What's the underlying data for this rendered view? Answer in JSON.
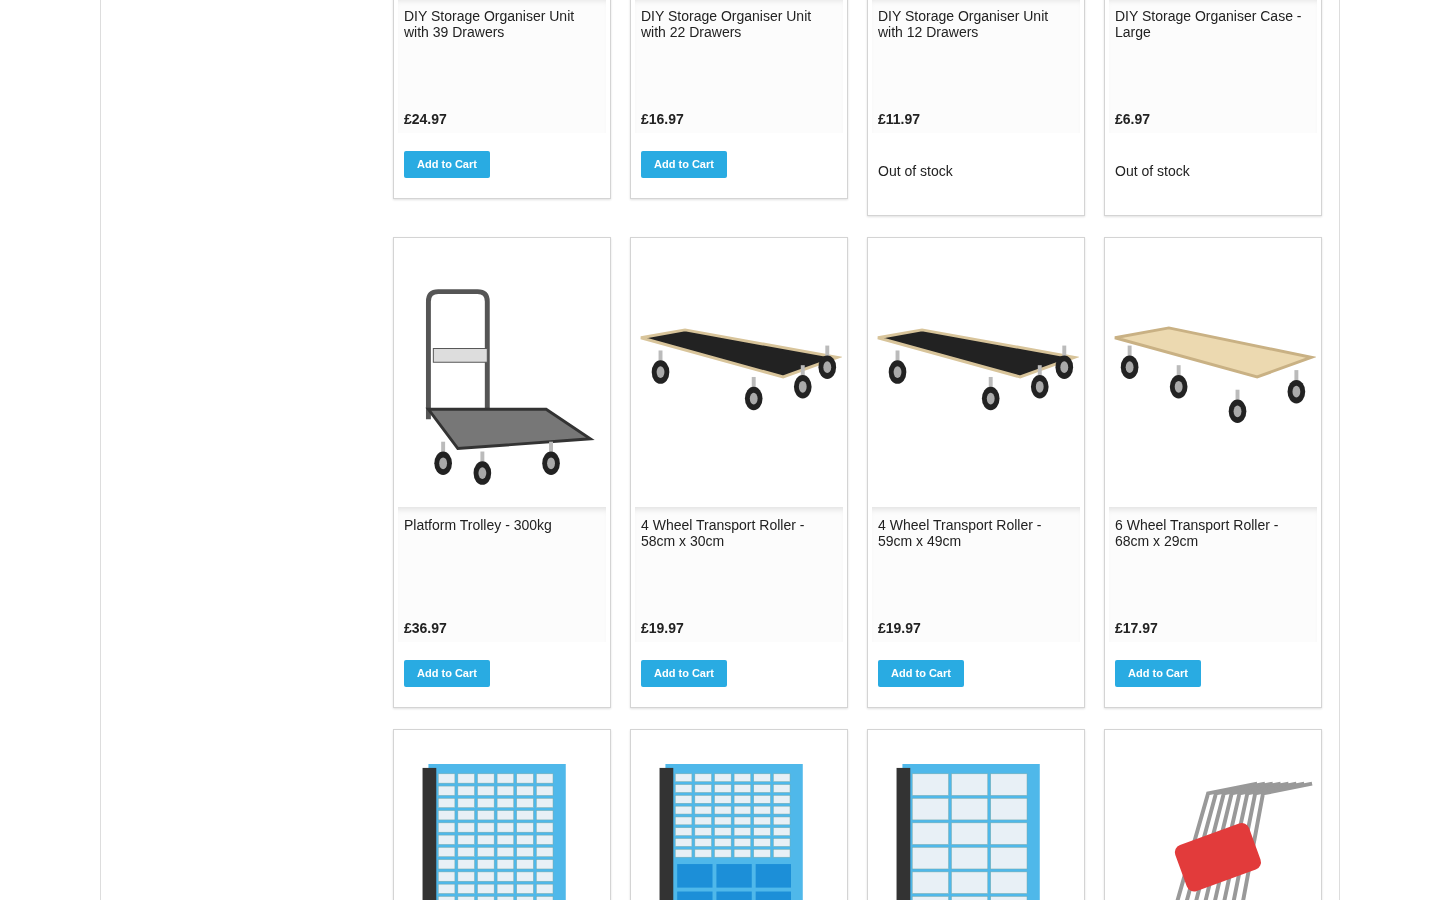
{
  "products": [
    {
      "title": "DIY Storage Organiser Unit with 39 Drawers",
      "price": "£24.97",
      "cart": {
        "kind": "button",
        "label": "Add to Cart"
      }
    },
    {
      "title": "DIY Storage Organiser Unit with 22 Drawers",
      "price": "£16.97",
      "cart": {
        "kind": "button",
        "label": "Add to Cart"
      }
    },
    {
      "title": "DIY Storage Organiser Unit with 12 Drawers",
      "price": "£11.97",
      "cart": {
        "kind": "text",
        "label": "Out of stock"
      }
    },
    {
      "title": "DIY Storage Organiser Case - Large",
      "price": "£6.97",
      "cart": {
        "kind": "text",
        "label": "Out of stock"
      }
    },
    {
      "kind": "trolley",
      "title": "Platform Trolley - 300kg",
      "price": "£36.97",
      "cart": {
        "kind": "button",
        "label": "Add to Cart"
      }
    },
    {
      "kind": "roller",
      "title": "4 Wheel Transport Roller - 58cm x 30cm",
      "price": "£19.97",
      "cart": {
        "kind": "button",
        "label": "Add to Cart"
      }
    },
    {
      "kind": "roller",
      "title": "4 Wheel Transport Roller - 59cm x 49cm",
      "price": "£19.97",
      "cart": {
        "kind": "button",
        "label": "Add to Cart"
      }
    },
    {
      "kind": "wooden",
      "title": "6 Wheel Transport Roller - 68cm x 29cm",
      "price": "£17.97",
      "cart": {
        "kind": "button",
        "label": "Add to Cart"
      }
    },
    {
      "kind": "organiser"
    },
    {
      "kind": "bins"
    },
    {
      "kind": "large"
    },
    {
      "kind": "keys"
    }
  ]
}
